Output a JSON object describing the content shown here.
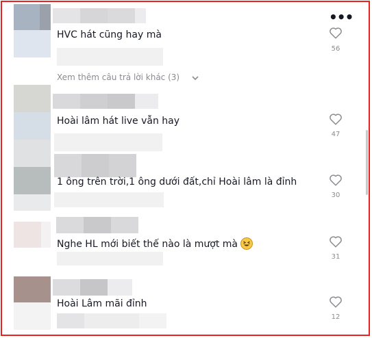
{
  "comments": [
    {
      "text": "HVC hát cũng hay mà",
      "likes": "56"
    },
    {
      "text": "Hoài lâm hát live vẫn hay",
      "likes": "47"
    },
    {
      "text": "1 ông trên trời,1 ông dưới đất,chỉ Hoài lâm là đỉnh",
      "likes": "30"
    },
    {
      "text": "Nghe HL mới biết thế nào là mượt mà",
      "likes": "31",
      "emoji": "laughing-face"
    },
    {
      "text": "Hoài Lâm mãi đỉnh",
      "likes": "12"
    }
  ],
  "view_more_replies": "Xem thêm câu trả lời khác (3)",
  "icons": {
    "more": "more-horizontal-icon",
    "like": "heart-outline-icon",
    "expand": "chevron-down-icon"
  },
  "colors": {
    "border": "#e8231f",
    "text": "#161823",
    "muted": "#8a8b91"
  }
}
